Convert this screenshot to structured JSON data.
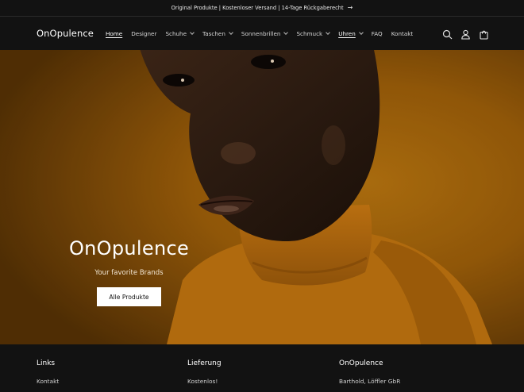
{
  "announcement": {
    "text": "Original Produkte | Kostenloser Versand | 14-Tage Rückgaberecht",
    "arrow": "→"
  },
  "header": {
    "logo": "OnOpulence",
    "nav": [
      {
        "label": "Home",
        "dropdown": false,
        "active": true
      },
      {
        "label": "Designer",
        "dropdown": false
      },
      {
        "label": "Schuhe",
        "dropdown": true
      },
      {
        "label": "Taschen",
        "dropdown": true
      },
      {
        "label": "Sonnenbrillen",
        "dropdown": true
      },
      {
        "label": "Schmuck",
        "dropdown": true
      },
      {
        "label": "Uhren",
        "dropdown": true,
        "underlined": true
      },
      {
        "label": "FAQ",
        "dropdown": false
      },
      {
        "label": "Kontakt",
        "dropdown": false
      }
    ],
    "icons": [
      "search-icon",
      "account-icon",
      "cart-icon"
    ]
  },
  "hero": {
    "title": "OnOpulence",
    "subtitle": "Your favorite Brands",
    "button_label": "Alle Produkte",
    "background_color": "#a5630a"
  },
  "footer": {
    "columns": [
      {
        "heading": "Links",
        "item": "Kontakt"
      },
      {
        "heading": "Lieferung",
        "item": "Kostenlos!"
      },
      {
        "heading": "OnOpulence",
        "item": "Barthold, Löffler GbR"
      }
    ]
  }
}
